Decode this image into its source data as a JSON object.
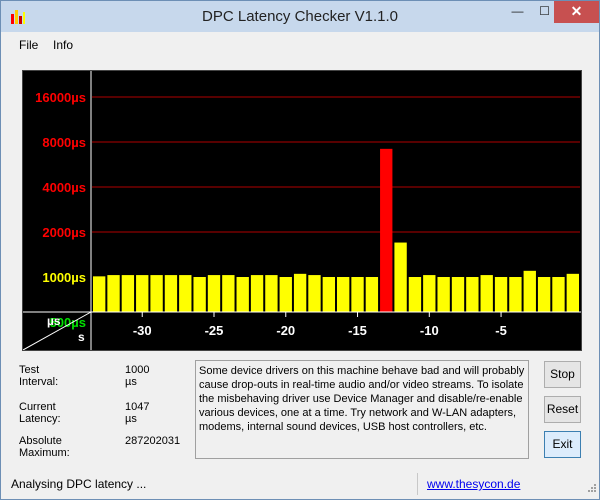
{
  "window": {
    "title": "DPC Latency Checker V1.1.0",
    "controls": {
      "minimize": "—",
      "maximize": "☐",
      "close": "✕"
    }
  },
  "menu": {
    "items": [
      "File",
      "Info"
    ]
  },
  "chart_data": {
    "type": "bar",
    "y_scale": "log2",
    "y_ticks": [
      {
        "label": "16000µs",
        "value": 16000,
        "color": "#ff0000"
      },
      {
        "label": "8000µs",
        "value": 8000,
        "color": "#ff0000"
      },
      {
        "label": "4000µs",
        "value": 4000,
        "color": "#ff0000"
      },
      {
        "label": "2000µs",
        "value": 2000,
        "color": "#ff0000"
      },
      {
        "label": "1000µs",
        "value": 1000,
        "color": "#ffff00"
      },
      {
        "label": "500µs",
        "value": 500,
        "color": "#00e000"
      }
    ],
    "x_ticks": [
      "-30",
      "-25",
      "-20",
      "-15",
      "-10",
      "-5"
    ],
    "x_tick_values": [
      -30,
      -25,
      -20,
      -15,
      -10,
      -5
    ],
    "x_range": [
      -33,
      0
    ],
    "corner_labels": {
      "y_unit": "µs",
      "x_unit": "s"
    },
    "threshold_colors": {
      "ok": "#ffff00",
      "high": "#ff0000"
    },
    "bars": [
      {
        "x": -33,
        "value": 1010
      },
      {
        "x": -32,
        "value": 1030
      },
      {
        "x": -31,
        "value": 1030
      },
      {
        "x": -30,
        "value": 1030
      },
      {
        "x": -29,
        "value": 1030
      },
      {
        "x": -28,
        "value": 1030
      },
      {
        "x": -27,
        "value": 1030
      },
      {
        "x": -26,
        "value": 1000
      },
      {
        "x": -25,
        "value": 1030
      },
      {
        "x": -24,
        "value": 1030
      },
      {
        "x": -23,
        "value": 1000
      },
      {
        "x": -22,
        "value": 1030
      },
      {
        "x": -21,
        "value": 1030
      },
      {
        "x": -20,
        "value": 1000
      },
      {
        "x": -19,
        "value": 1050
      },
      {
        "x": -18,
        "value": 1030
      },
      {
        "x": -17,
        "value": 1000
      },
      {
        "x": -16,
        "value": 1000
      },
      {
        "x": -15,
        "value": 1000
      },
      {
        "x": -14,
        "value": 1000
      },
      {
        "x": -13,
        "value": 7200,
        "color": "#ff0000"
      },
      {
        "x": -12,
        "value": 1700
      },
      {
        "x": -11,
        "value": 1000
      },
      {
        "x": -10,
        "value": 1030
      },
      {
        "x": -9,
        "value": 1000
      },
      {
        "x": -8,
        "value": 1000
      },
      {
        "x": -7,
        "value": 1000
      },
      {
        "x": -6,
        "value": 1030
      },
      {
        "x": -5,
        "value": 1000
      },
      {
        "x": -4,
        "value": 1000
      },
      {
        "x": -3,
        "value": 1100
      },
      {
        "x": -2,
        "value": 1000
      },
      {
        "x": -1,
        "value": 1000
      },
      {
        "x": 0,
        "value": 1050
      }
    ]
  },
  "info": {
    "test_interval_label": "Test Interval:",
    "test_interval_value": "1000 µs",
    "current_latency_label": "Current Latency:",
    "current_latency_value": "1047 µs",
    "absolute_max_label": "Absolute Maximum:",
    "absolute_max_value": "287202031"
  },
  "message": "Some device drivers on this machine behave bad and will probably cause drop-outs in real-time audio and/or video streams. To isolate the misbehaving driver use Device Manager and disable/re-enable various devices, one at a time. Try network and W-LAN adapters, modems, internal sound devices, USB host controllers, etc.",
  "buttons": {
    "stop": "Stop",
    "reset": "Reset",
    "exit": "Exit"
  },
  "status": {
    "text": "Analysing DPC latency ...",
    "link": "www.thesycon.de"
  }
}
